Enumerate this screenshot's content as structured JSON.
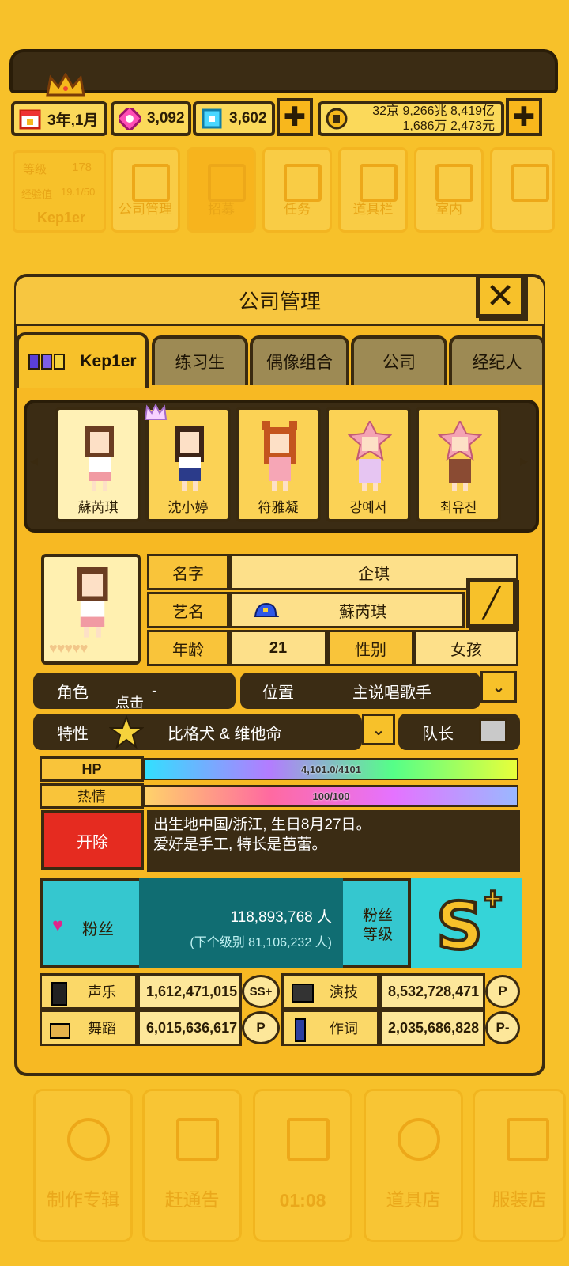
{
  "header": {
    "date": "3年,1月",
    "pink_gems": "3,092",
    "blue_gems": "3,602",
    "money_line1": "32京 9,266兆 8,419亿",
    "money_line2": "1,686万 2,473元"
  },
  "faded_nav": {
    "level_label": "等级",
    "level_value": "178",
    "exp_label": "经验值",
    "exp_value": "19.1/50",
    "group_name": "Kep1er",
    "items": [
      "公司管理",
      "招募",
      "任务",
      "道具栏",
      "室内"
    ]
  },
  "panel": {
    "title": "公司管理",
    "tabs": [
      "Kep1er",
      "练习生",
      "偶像组合",
      "公司",
      "经纪人"
    ],
    "roster": [
      "蘇芮琪",
      "沈小婷",
      "符雅凝",
      "강예서",
      "최유진"
    ]
  },
  "member": {
    "name_label": "名字",
    "name_value": "企琪",
    "stage_name_label": "艺名",
    "stage_name_value": "蘇芮琪",
    "age_label": "年龄",
    "age_value": "21",
    "gender_label": "性别",
    "gender_value": "女孩",
    "role_label": "角色",
    "role_value": "-",
    "tap_hint": "点击",
    "position_label": "位置",
    "position_value": "主说唱歌手",
    "trait_label": "特性",
    "trait_value": "比格犬 & 维他命",
    "leader_label": "队长",
    "hp_label": "HP",
    "hp_value": "4,101.0/4101",
    "passion_label": "热情",
    "passion_value": "100/100",
    "fire_label": "开除",
    "bio_line1": "出生地中国/浙江, 生日8月27日。",
    "bio_line2": "爱好是手工, 特长是芭蕾。"
  },
  "fans": {
    "label": "粉丝",
    "count": "118,893,768 人",
    "next": "(下个级别 81,106,232 人)",
    "grade_label_1": "粉丝",
    "grade_label_2": "等级",
    "grade": "S",
    "grade_plus": "+"
  },
  "stats": [
    {
      "name": "声乐",
      "value": "1,612,471,015",
      "grade": "SS+"
    },
    {
      "name": "演技",
      "value": "8,532,728,471",
      "grade": "P"
    },
    {
      "name": "舞蹈",
      "value": "6,015,636,617",
      "grade": "P"
    },
    {
      "name": "作词",
      "value": "2,035,686,828",
      "grade": "P-"
    }
  ],
  "bottom_nav": [
    "制作专辑",
    "赶通告",
    "01:08",
    "道具店",
    "服装店"
  ],
  "colors": {
    "background": "#f7c12a",
    "panel": "#f7b923",
    "dark": "#3b2c14",
    "fans_teal": "#35c7cf",
    "fire_red": "#e52b20"
  }
}
